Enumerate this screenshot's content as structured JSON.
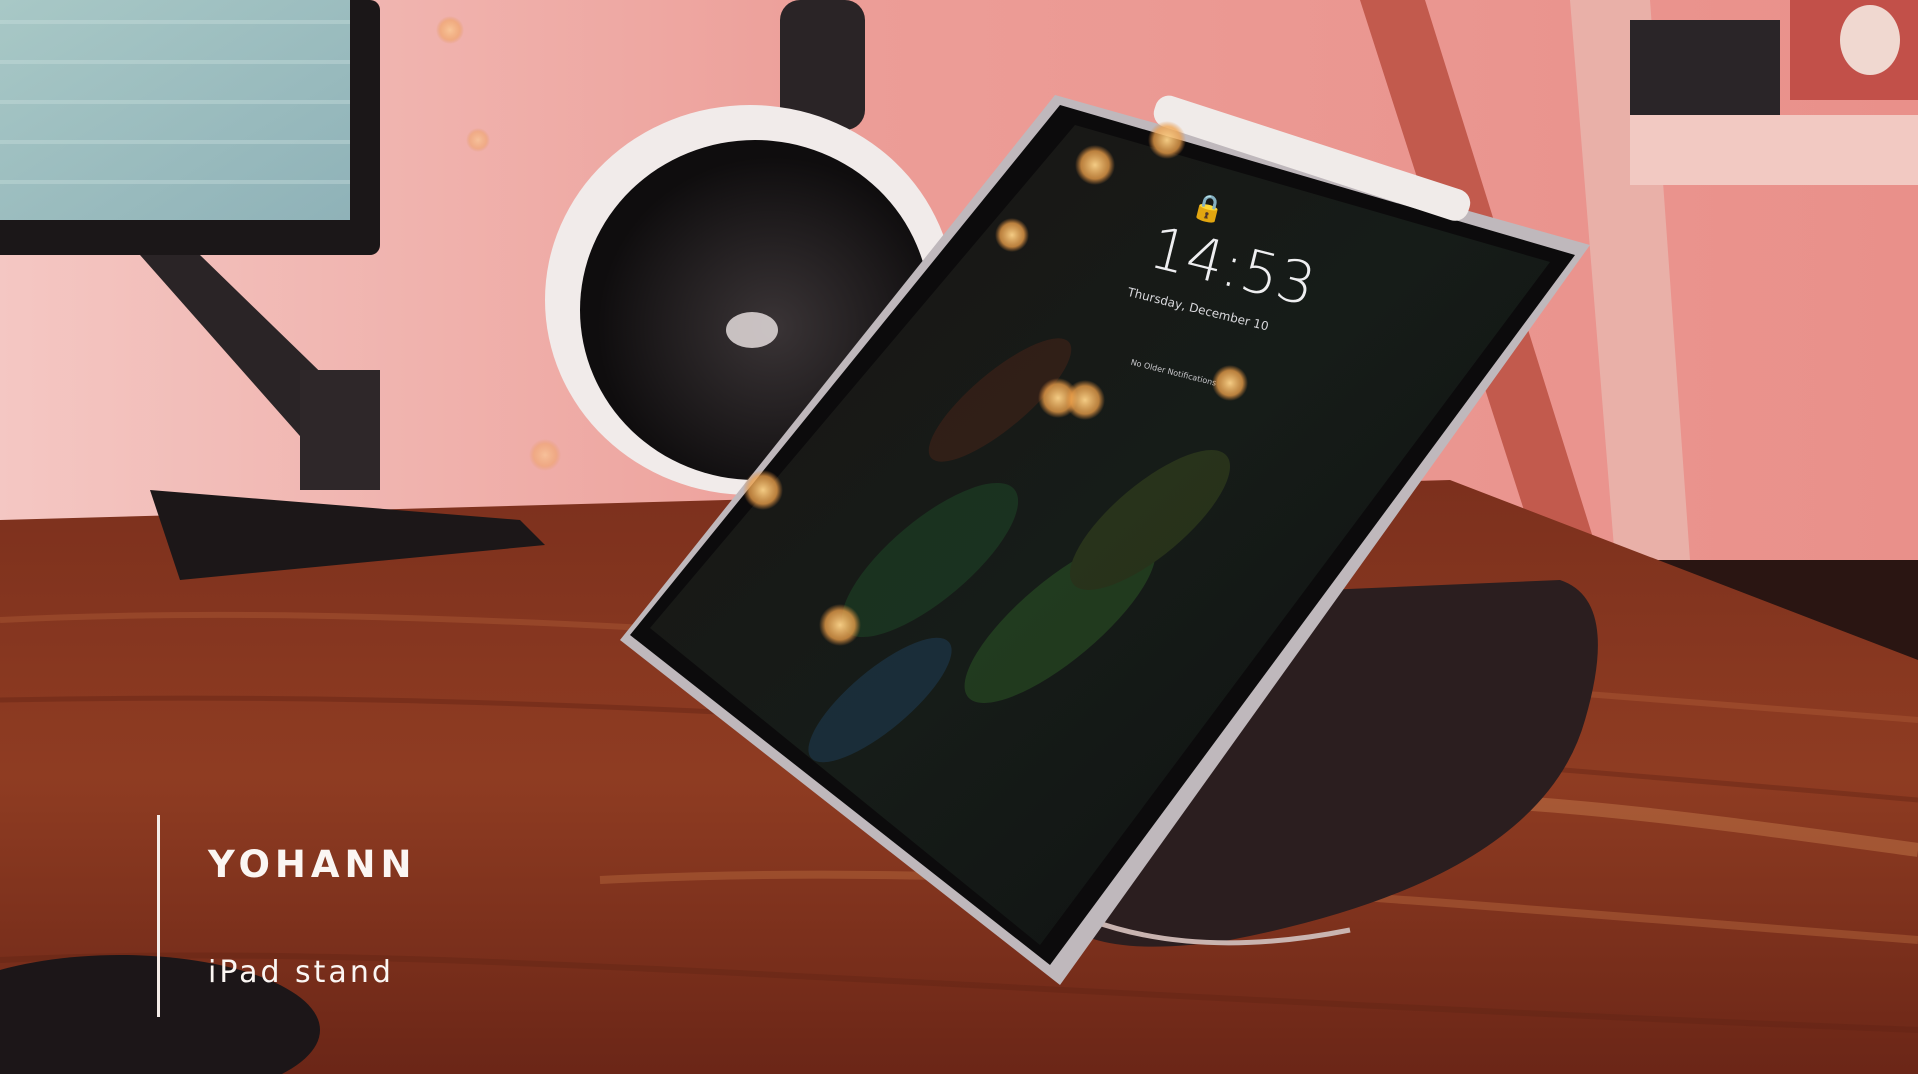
{
  "lockscreen": {
    "time": "14:53",
    "date": "Thursday, December 10",
    "notice": "No Older Notifications"
  },
  "caption": {
    "title": "YOHANN",
    "subtitle": "iPad stand"
  },
  "colors": {
    "wall": "#e9958f",
    "desk": "#8a3a22",
    "caption_text": "#fbf6f3"
  }
}
